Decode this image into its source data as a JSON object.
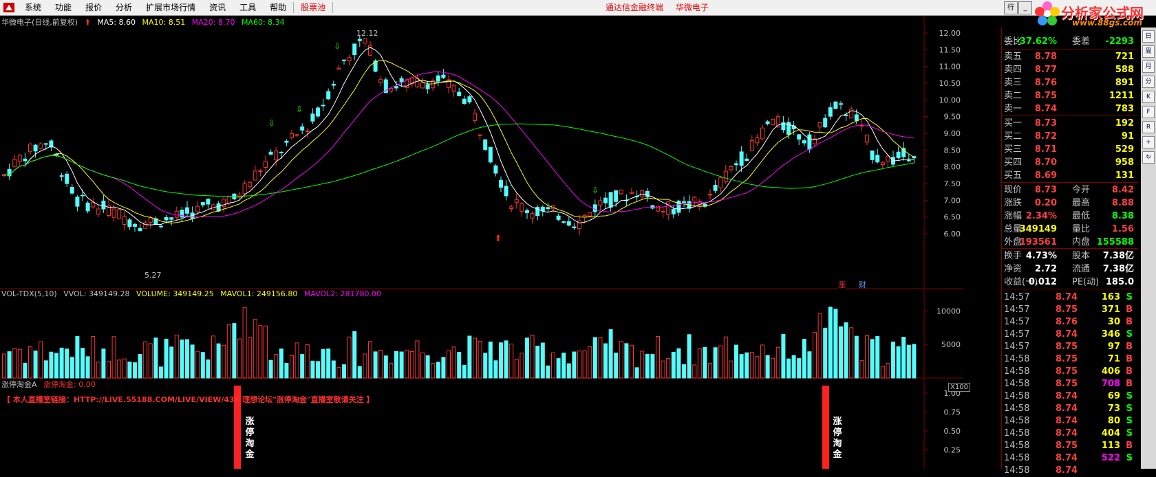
{
  "menu": {
    "items": [
      "系统",
      "功能",
      "报价",
      "分析",
      "扩展市场行情",
      "资讯",
      "工具",
      "帮助"
    ],
    "highlight": "股票池",
    "center_items": [
      "通达信金融终端",
      "华微电子"
    ],
    "right_truncated": "行",
    "window_buttons": [
      "_",
      "□",
      "×"
    ]
  },
  "brand": {
    "name": "分析家公式网",
    "url": "www.88gs.com"
  },
  "chart_header": {
    "title": "华微电子(日线,前复权)",
    "ma5": "MA5: 8.60",
    "ma10": "MA10: 8.51",
    "ma20": "MA20: 8.70",
    "ma60": "MA60: 8.34",
    "hi_label": "12.12",
    "lo_label": "5.27"
  },
  "volume_header": {
    "name": "VOL-TDX(5,10)",
    "vvol": "VVOL: 349149.28",
    "volume": "VOLUME: 349149.25",
    "mavol1": "MAVOL1: 249156.80",
    "mavol2": "MAVOL2: 281780.00",
    "unit": "X100"
  },
  "indicator_header": {
    "name": "涨停淘金A",
    "value": "涨停淘金: 0.00",
    "banner": "【 本人直播室链接：HTTP://LIVE.55188.COM/LIVE/VIEW/438 理想论坛\"涨停淘金\"直播室敬请关注 】",
    "marker_text": "涨停淘金"
  },
  "tags": {
    "zhang": "涨",
    "cai": "财"
  },
  "colors": {
    "up": "#ff3232",
    "down": "#54fcfc",
    "ma5": "#ffffff",
    "ma10": "#ffff00",
    "ma20": "#ff00ff",
    "ma60": "#00ff00",
    "vol_line1": "#ffff00",
    "vol_line2": "#ff00ff",
    "panel_border": "#800000"
  },
  "price_axis": [
    "12.00",
    "11.50",
    "11.00",
    "10.50",
    "10.00",
    "9.50",
    "9.00",
    "8.50",
    "8.00",
    "7.50",
    "7.00",
    "6.50",
    "6.00"
  ],
  "volume_axis": [
    "10000",
    "5000"
  ],
  "indicator_axis": [
    "1.00",
    "0.75",
    "0.50",
    "0.25"
  ],
  "quote_panel": {
    "top": {
      "wb_label": "委比",
      "wb_value": "-37.62%",
      "wc_label": "委差",
      "wc_value": "-2293"
    },
    "asks": [
      {
        "label": "卖五",
        "price": "8.78",
        "vol": "721"
      },
      {
        "label": "卖四",
        "price": "8.77",
        "vol": "588"
      },
      {
        "label": "卖三",
        "price": "8.76",
        "vol": "891"
      },
      {
        "label": "卖二",
        "price": "8.75",
        "vol": "1211"
      },
      {
        "label": "卖一",
        "price": "8.74",
        "vol": "783"
      }
    ],
    "bids": [
      {
        "label": "买一",
        "price": "8.73",
        "vol": "192"
      },
      {
        "label": "买二",
        "price": "8.72",
        "vol": "91"
      },
      {
        "label": "买三",
        "price": "8.71",
        "vol": "529"
      },
      {
        "label": "买四",
        "price": "8.70",
        "vol": "958"
      },
      {
        "label": "买五",
        "price": "8.69",
        "vol": "131"
      }
    ],
    "stats": [
      {
        "l1": "现价",
        "v1": "8.73",
        "l2": "今开",
        "v2": "8.42"
      },
      {
        "l1": "涨跌",
        "v1": "0.20",
        "l2": "最高",
        "v2": "8.88"
      },
      {
        "l1": "涨幅",
        "v1": "2.34%",
        "l2": "最低",
        "v2": "8.38"
      },
      {
        "l1": "总量",
        "v1": "349149",
        "l2": "量比",
        "v2": "1.56"
      },
      {
        "l1": "外盘",
        "v1": "193561",
        "l2": "内盘",
        "v2": "155588"
      }
    ],
    "fin": [
      {
        "l1": "换手",
        "v1": "4.73%",
        "l2": "股本",
        "v2": "7.38亿"
      },
      {
        "l1": "净资",
        "v1": "2.72",
        "l2": "流通",
        "v2": "7.38亿"
      },
      {
        "l1": "收益(一)",
        "v1": "0.012",
        "l2": "PE(动)",
        "v2": "185.0"
      }
    ],
    "ticks": [
      {
        "t": "14:57",
        "p": "8.74",
        "v": "163",
        "s": "S"
      },
      {
        "t": "14:57",
        "p": "8.75",
        "v": "371",
        "s": "B"
      },
      {
        "t": "14:57",
        "p": "8.76",
        "v": "30",
        "s": "B"
      },
      {
        "t": "14:57",
        "p": "8.74",
        "v": "346",
        "s": "S"
      },
      {
        "t": "14:57",
        "p": "8.75",
        "v": "97",
        "s": "B"
      },
      {
        "t": "14:58",
        "p": "8.75",
        "v": "71",
        "s": "B"
      },
      {
        "t": "14:58",
        "p": "8.75",
        "v": "406",
        "s": "B"
      },
      {
        "t": "14:58",
        "p": "8.75",
        "v": "708",
        "s": "B"
      },
      {
        "t": "14:58",
        "p": "8.74",
        "v": "69",
        "s": "S"
      },
      {
        "t": "14:58",
        "p": "8.74",
        "v": "73",
        "s": "S"
      },
      {
        "t": "14:58",
        "p": "8.74",
        "v": "80",
        "s": "S"
      },
      {
        "t": "14:58",
        "p": "8.74",
        "v": "404",
        "s": "S"
      },
      {
        "t": "14:58",
        "p": "8.75",
        "v": "113",
        "s": "B"
      },
      {
        "t": "14:58",
        "p": "8.74",
        "v": "522",
        "s": "S"
      },
      {
        "t": "14:58",
        "p": "8.74",
        "v": "",
        "s": ""
      }
    ]
  },
  "side_tools": [
    "日",
    "周",
    "月",
    "分",
    "K",
    "F",
    "R",
    "+",
    "↻"
  ]
}
